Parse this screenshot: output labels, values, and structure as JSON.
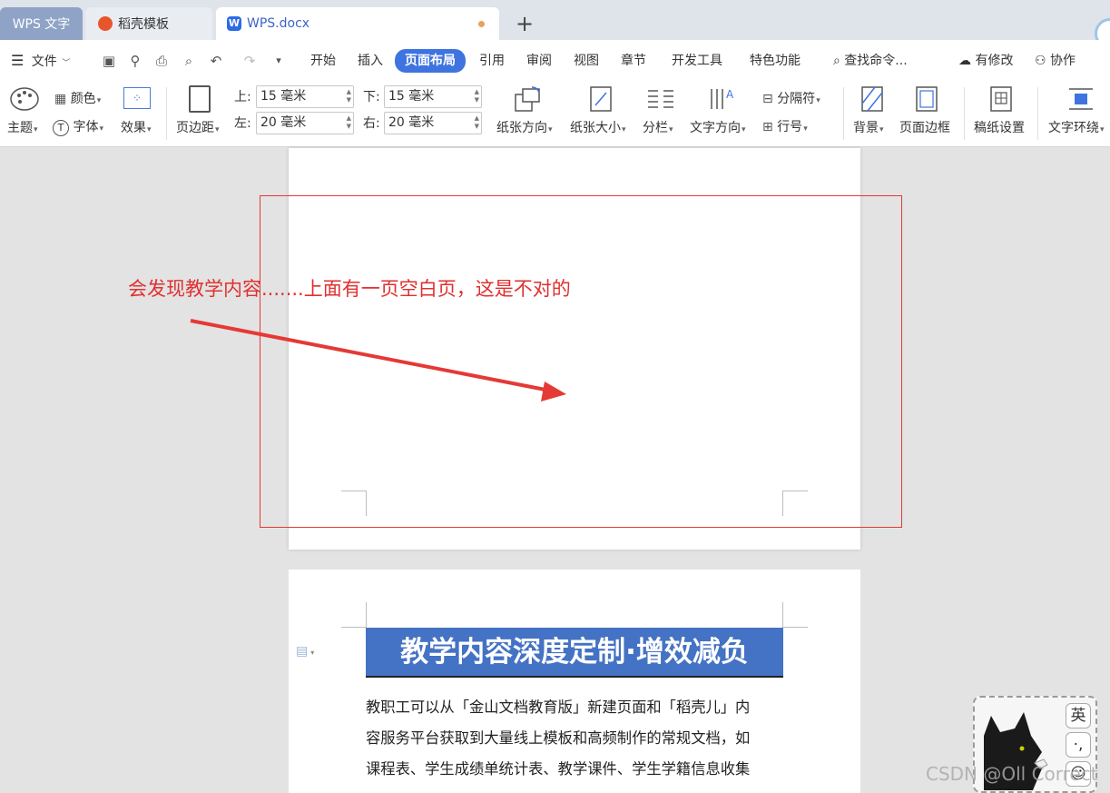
{
  "tabs": {
    "app": "WPS 文字",
    "template": "稻壳模板",
    "document": "WPS.docx",
    "add": "+"
  },
  "menu": {
    "file": "文件",
    "items": [
      "开始",
      "插入",
      "页面布局",
      "引用",
      "审阅",
      "视图",
      "章节",
      "开发工具",
      "特色功能"
    ],
    "active": "页面布局",
    "search": "查找命令...",
    "changes": "有修改",
    "collab": "协作"
  },
  "ribbon": {
    "theme": "主题",
    "color": "颜色",
    "font": "字体",
    "effect": "效果",
    "margins": "页边距",
    "top_label": "上:",
    "top_value": "15 毫米",
    "bottom_label": "下:",
    "bottom_value": "15 毫米",
    "left_label": "左:",
    "left_value": "20 毫米",
    "right_label": "右:",
    "right_value": "20 毫米",
    "orientation": "纸张方向",
    "size": "纸张大小",
    "columns": "分栏",
    "text_direction": "文字方向",
    "breaks": "分隔符",
    "line_numbers": "行号",
    "background": "背景",
    "page_border": "页面边框",
    "manuscript": "稿纸设置",
    "text_wrap": "文字环绕"
  },
  "annotation": {
    "text": "会发现教学内容.......上面有一页空白页，这是不对的",
    "color": "#e53935"
  },
  "document": {
    "title": "教学内容深度定制·增效减负",
    "title_bg": "#4472c4",
    "body_lines": [
      "教职工可以从「金山文档教育版」新建页面和「稻壳儿」内",
      "容服务平台获取到大量线上模板和高频制作的常规文档，如",
      "课程表、学生成绩单统计表、教学课件、学生学籍信息收集"
    ]
  },
  "ime": {
    "lang": "英",
    "punct": "·,",
    "emoji": "☺"
  },
  "watermark": "CSDN @Oll Correct"
}
